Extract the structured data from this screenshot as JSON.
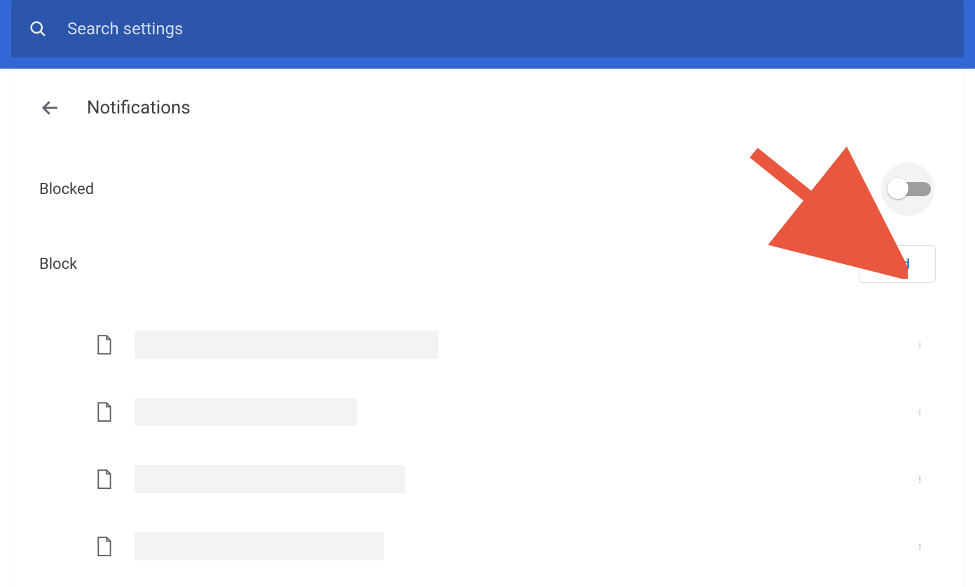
{
  "search": {
    "placeholder": "Search settings"
  },
  "header": {
    "title": "Notifications"
  },
  "main_setting": {
    "label": "Blocked",
    "toggle_on": false
  },
  "block_section": {
    "title": "Block",
    "add_label": "Add",
    "sites": [
      {
        "redacted_width": 434
      },
      {
        "redacted_width": 318
      },
      {
        "redacted_width": 386
      },
      {
        "redacted_width": 356
      }
    ]
  }
}
